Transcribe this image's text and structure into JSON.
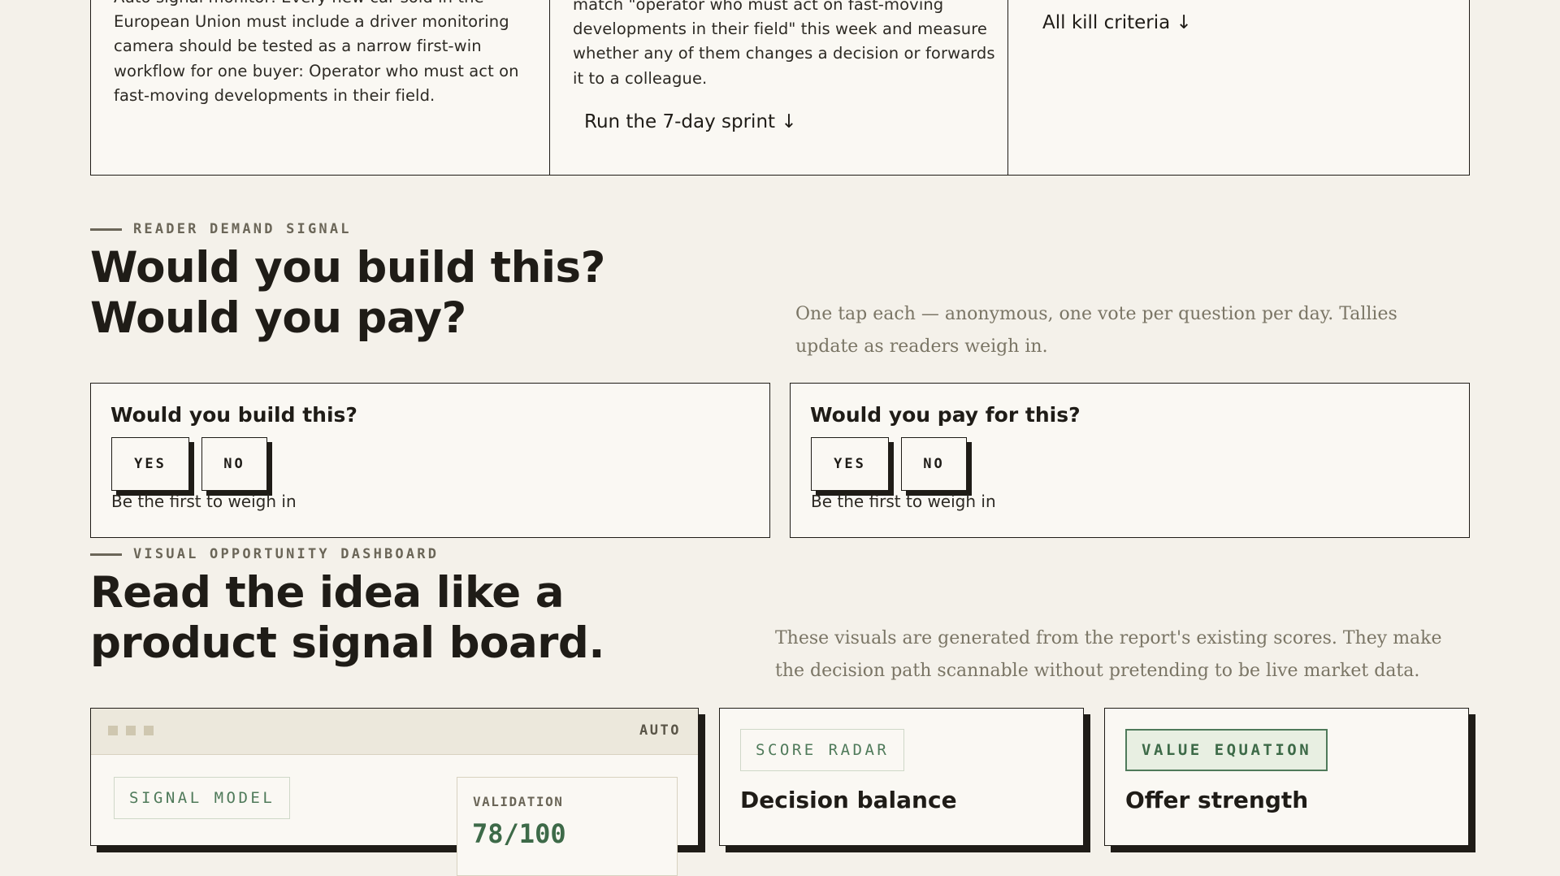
{
  "top_cards": {
    "card1_text": "Auto signal monitor: Every new car sold in the European Union must include a driver monitoring camera should be tested as a narrow first-win workflow for one buyer: Operator who must act on fast-moving developments in their field.",
    "card2_text": "match \"operator who must act on fast-moving developments in their field\" this week and measure whether any of them changes a decision or forwards it to a colleague.",
    "card2_link": "Run the 7-day sprint ↓",
    "card3_link": "All kill criteria ↓"
  },
  "demand": {
    "eyebrow": "READER DEMAND SIGNAL",
    "title": "Would you build this? Would you pay?",
    "lede": "One tap each — anonymous, one vote per question per day. Tallies update as readers weigh in.",
    "polls": [
      {
        "question": "Would you build this?",
        "yes": "YES",
        "no": "NO",
        "status": "Be the first to weigh in"
      },
      {
        "question": "Would you pay for this?",
        "yes": "YES",
        "no": "NO",
        "status": "Be the first to weigh in"
      }
    ]
  },
  "dashboard": {
    "eyebrow": "VISUAL OPPORTUNITY DASHBOARD",
    "title": "Read the idea like a product signal board.",
    "lede": "These visuals are generated from the report's existing scores. They make the decision path scannable without pretending to be live market data.",
    "signal_card": {
      "tag": "AUTO",
      "pill": "SIGNAL MODEL",
      "validation_label": "VALIDATION",
      "validation_value": "78/100"
    },
    "radar_card": {
      "pill": "SCORE RADAR",
      "title": "Decision balance"
    },
    "value_card": {
      "pill": "VALUE EQUATION",
      "title": "Offer strength"
    }
  },
  "colors": {
    "accent": "#4f7a5a",
    "ink": "#1f1c17",
    "paper": "#faf8f3",
    "background": "#f4f1ea"
  }
}
